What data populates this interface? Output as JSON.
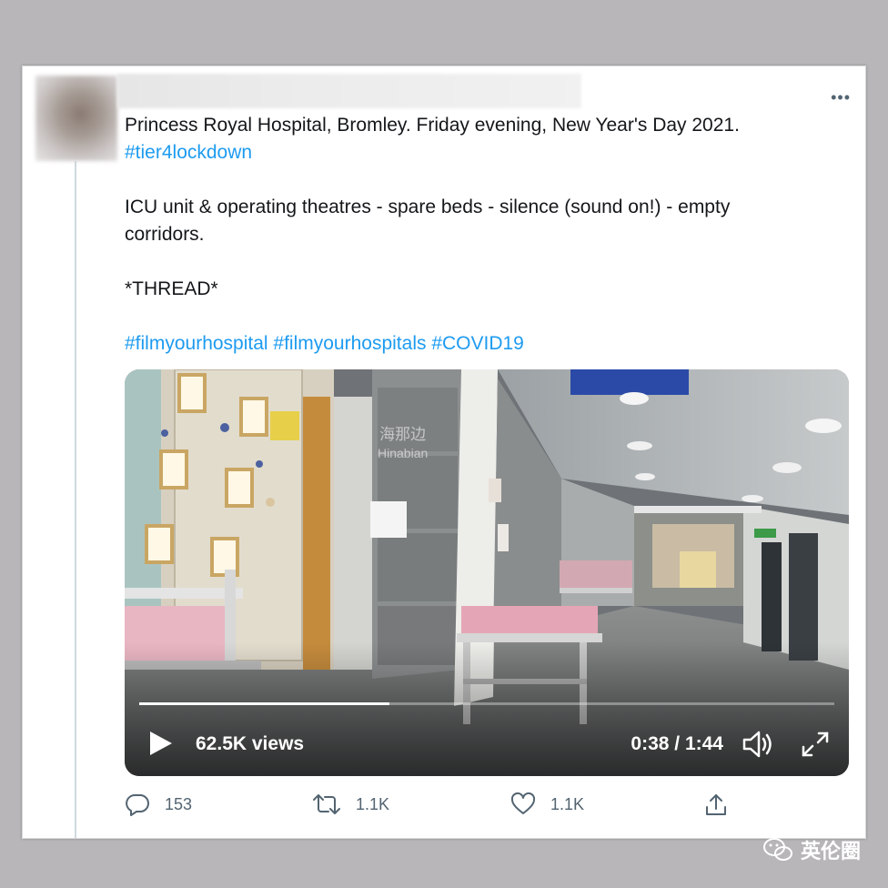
{
  "tweet": {
    "line1": "Princess Royal Hospital, Bromley. Friday evening, New Year's Day 2021.",
    "hashtag_line": "#tier4lockdown",
    "line2a": "ICU unit & operating theatres - spare beds - silence (sound on!) - empty",
    "line2b": "corridors.",
    "line3": "*THREAD*",
    "hashtags": "#filmyourhospital #filmyourhospitals #COVID19",
    "more_icon": "more-dots-icon"
  },
  "video": {
    "views": "62.5K views",
    "time": "0:38 / 1:44",
    "progress": 0.36,
    "watermark_cn": "海那边",
    "watermark_en": "Hinabian"
  },
  "actions": {
    "reply_count": "153",
    "retweet_count": "1.1K",
    "like_count": "1.1K"
  },
  "brand": {
    "label": "英伦圈"
  },
  "colors": {
    "link": "#1d9bf0",
    "text": "#14171a",
    "muted": "#536471",
    "background": "#b8b6b9"
  }
}
